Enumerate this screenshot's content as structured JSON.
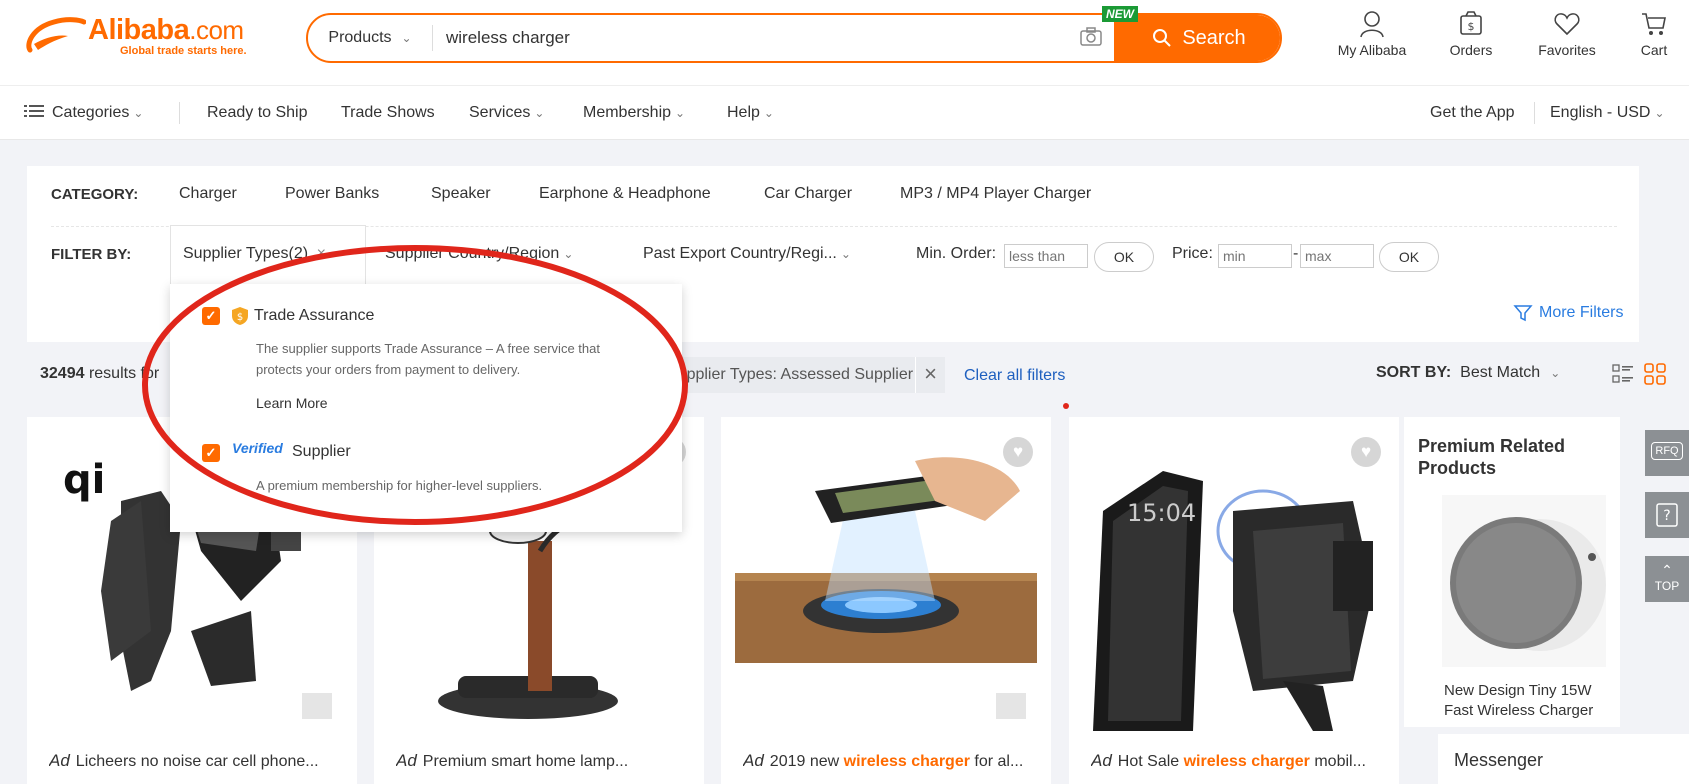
{
  "header": {
    "logo": {
      "name": "Alibaba",
      "dotcom": ".com",
      "tagline": "Global trade starts here."
    },
    "search": {
      "category": "Products",
      "query": "wireless charger",
      "button_label": "Search",
      "new_badge": "NEW"
    },
    "items": [
      {
        "label": "My Alibaba",
        "icon": "user-icon"
      },
      {
        "label": "Orders",
        "icon": "orders-icon"
      },
      {
        "label": "Favorites",
        "icon": "heart-icon"
      },
      {
        "label": "Cart",
        "icon": "cart-icon"
      }
    ]
  },
  "nav": {
    "categories": "Categories",
    "items": [
      "Ready to Ship",
      "Trade Shows",
      "Services",
      "Membership",
      "Help"
    ],
    "get_app": "Get the App",
    "language": "English - USD"
  },
  "filter_panel": {
    "category_label": "CATEGORY:",
    "categories": [
      "Charger",
      "Power Banks",
      "Speaker",
      "Earphone & Headphone",
      "Car Charger",
      "MP3 / MP4 Player Charger"
    ],
    "filter_label": "FILTER BY:",
    "supplier_types": "Supplier Types(2)",
    "supplier_country": "Supplier Country/Region",
    "past_export": "Past Export Country/Regi...",
    "min_order_label": "Min. Order:",
    "min_order_placeholder": "less than",
    "ok": "OK",
    "price_label": "Price:",
    "price_min_placeholder": "min",
    "price_dash": "-",
    "price_max_placeholder": "max",
    "more_filters": "More Filters"
  },
  "results": {
    "count": "32494",
    "count_suffix": " results for",
    "active_filter": "Supplier Types: Assessed Supplier",
    "clear_all": "Clear all filters",
    "sort_label": "SORT BY:",
    "sort_value": "Best Match"
  },
  "dropdown": {
    "trade_assurance": {
      "title": "Trade Assurance",
      "description": "The supplier supports Trade Assurance – A free service that protects your orders from payment to delivery.",
      "learn_more": "Learn More"
    },
    "verified": {
      "logo": "Verified",
      "title": "Supplier",
      "description": "A premium membership for higher-level suppliers."
    }
  },
  "products": [
    {
      "ad": "Ad",
      "before": "Licheers no noise car cell phone...",
      "highlight": "",
      "after": ""
    },
    {
      "ad": "Ad",
      "before": "Premium smart home lamp...",
      "highlight": "",
      "after": ""
    },
    {
      "ad": "Ad",
      "before": "2019 new ",
      "highlight": "wireless charger",
      "after": " for al..."
    },
    {
      "ad": "Ad",
      "before": "Hot Sale ",
      "highlight": "wireless charger",
      "after": " mobil..."
    }
  ],
  "premium": {
    "title": "Premium Related Products",
    "product_name": "New Design Tiny 15W Fast Wireless Charger"
  },
  "messenger": "Messenger",
  "side_tools": {
    "rfq": "RFQ",
    "top": "TOP"
  },
  "colors": {
    "brand": "#ff6a00",
    "link": "#1e5fbf",
    "highlight_ellipse": "#e0261b"
  }
}
